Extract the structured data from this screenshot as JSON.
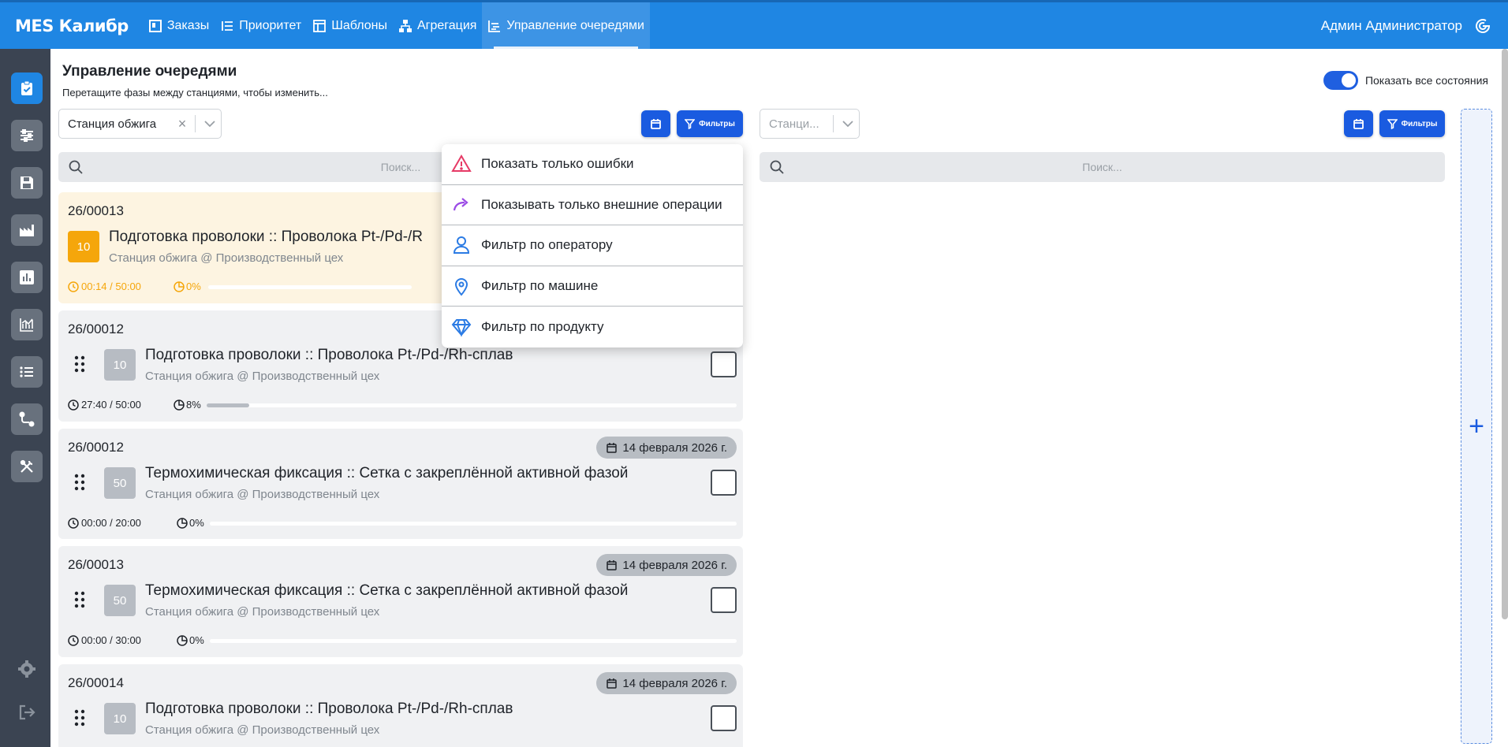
{
  "app": {
    "brand": "MES Калибр",
    "user": "Админ Администратор"
  },
  "nav": {
    "orders": "Заказы",
    "priority": "Приоритет",
    "templates": "Шаблоны",
    "aggregation": "Агрегация",
    "queue": "Управление очередями"
  },
  "sidebar": {
    "items": [
      "queue-check-icon",
      "sliders-icon",
      "save-icon",
      "factory-icon",
      "bar-chart-icon",
      "line-chart-icon",
      "list-icon",
      "route-icon",
      "tools-icon"
    ],
    "bottom": [
      "gear-icon",
      "logout-icon"
    ]
  },
  "header": {
    "title": "Управление очередями",
    "subtitle": "Перетащите фазы между станциями, чтобы изменить...",
    "toggle_label": "Показать все состояния",
    "toggle_on": true
  },
  "left": {
    "station_value": "Станция обжига",
    "filters_label": "Фильтры",
    "search_placeholder": "Поиск..."
  },
  "right": {
    "station_placeholder": "Станци...",
    "filters_label": "Фильтры",
    "search_placeholder": "Поиск..."
  },
  "dropdown": {
    "items": [
      "Показать только ошибки",
      "Показывать только внешние операции",
      "Фильтр по оператору",
      "Фильтр по машине",
      "Фильтр по продукту"
    ]
  },
  "cards": [
    {
      "code": "26/00013",
      "badge": "10",
      "name": "Подготовка проволоки :: Проволока Pt-/Pd-/R",
      "station": "Станция обжига @ Производственный цех",
      "time": "00:14 / 50:00",
      "pct": "0%",
      "progress": 0,
      "running": true
    },
    {
      "code": "26/00012",
      "badge": "10",
      "name": "Подготовка проволоки :: Проволока Pt-/Pd-/Rh-сплав",
      "station": "Станция обжига @ Производственный цех",
      "time": "27:40 / 50:00",
      "pct": "8%",
      "progress": 8
    },
    {
      "code": "26/00012",
      "badge": "50",
      "name": "Термохимическая фиксация :: Сетка с закреплённой активной фазой",
      "station": "Станция обжига @ Производственный цех",
      "time": "00:00 / 20:00",
      "pct": "0%",
      "progress": 0,
      "date": "14 февраля 2026 г."
    },
    {
      "code": "26/00013",
      "badge": "50",
      "name": "Термохимическая фиксация :: Сетка с закреплённой активной фазой",
      "station": "Станция обжига @ Производственный цех",
      "time": "00:00 / 30:00",
      "pct": "0%",
      "progress": 0,
      "date": "14 февраля 2026 г."
    },
    {
      "code": "26/00014",
      "badge": "10",
      "name": "Подготовка проволоки :: Проволока Pt-/Pd-/Rh-сплав",
      "station": "Станция обжига @ Производственный цех",
      "date": "14 февраля 2026 г."
    }
  ],
  "colors": {
    "topbar": "#1f86e3",
    "sidebar": "#3b4452",
    "accent": "#1a5be0",
    "running": "#f5a60b"
  }
}
